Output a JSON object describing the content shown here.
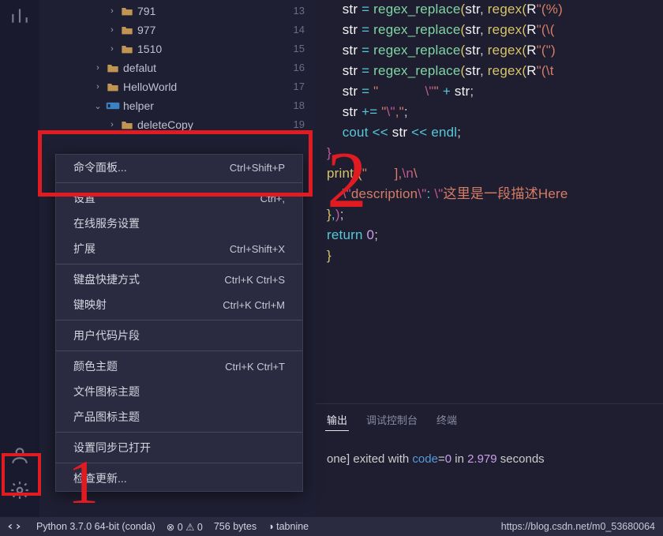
{
  "tree": [
    {
      "indent": 86,
      "chev": "›",
      "icon": "folder",
      "label": "791"
    },
    {
      "indent": 86,
      "chev": "›",
      "icon": "folder",
      "label": "977"
    },
    {
      "indent": 86,
      "chev": "›",
      "icon": "folder",
      "label": "1510"
    },
    {
      "indent": 68,
      "chev": "›",
      "icon": "folder",
      "label": "defalut"
    },
    {
      "indent": 68,
      "chev": "›",
      "icon": "folder",
      "label": "HelloWorld"
    },
    {
      "indent": 68,
      "chev": "⌄",
      "icon": "module",
      "label": "helper"
    },
    {
      "indent": 86,
      "chev": "›",
      "icon": "folder",
      "label": "deleteCopy"
    }
  ],
  "gutter": [
    "13",
    "14",
    "15",
    "16",
    "17",
    "18",
    "19"
  ],
  "menu": [
    {
      "label": "命令面板...",
      "shortcut": "Ctrl+Shift+P",
      "hi": true
    },
    {
      "sep": true
    },
    {
      "label": "设置",
      "shortcut": "Ctrl+,"
    },
    {
      "label": "在线服务设置",
      "shortcut": ""
    },
    {
      "label": "扩展",
      "shortcut": "Ctrl+Shift+X"
    },
    {
      "sep": true
    },
    {
      "label": "键盘快捷方式",
      "shortcut": "Ctrl+K Ctrl+S"
    },
    {
      "label": "键映射",
      "shortcut": "Ctrl+K Ctrl+M"
    },
    {
      "sep": true
    },
    {
      "label": "用户代码片段",
      "shortcut": ""
    },
    {
      "sep": true
    },
    {
      "label": "颜色主题",
      "shortcut": "Ctrl+K Ctrl+T"
    },
    {
      "label": "文件图标主题",
      "shortcut": ""
    },
    {
      "label": "产品图标主题",
      "shortcut": ""
    },
    {
      "sep": true
    },
    {
      "label": "设置同步已打开",
      "shortcut": ""
    },
    {
      "sep": true
    },
    {
      "label": "检查更新...",
      "shortcut": ""
    }
  ],
  "code_lines": [
    [
      [
        "    ",
        "p"
      ],
      [
        "str",
        "i"
      ],
      [
        " = ",
        "o"
      ],
      [
        "regex_replace",
        "f"
      ],
      [
        "(",
        "b"
      ],
      [
        "str",
        "i"
      ],
      [
        ", ",
        "p"
      ],
      [
        "regex",
        "c"
      ],
      [
        "(",
        "b"
      ],
      [
        "R",
        "i"
      ],
      [
        "\"(%)",
        "s"
      ]
    ],
    [
      [
        "    ",
        "p"
      ],
      [
        "str",
        "i"
      ],
      [
        " = ",
        "o"
      ],
      [
        "regex_replace",
        "f"
      ],
      [
        "(",
        "b"
      ],
      [
        "str",
        "i"
      ],
      [
        ", ",
        "p"
      ],
      [
        "regex",
        "c"
      ],
      [
        "(",
        "b"
      ],
      [
        "R",
        "i"
      ],
      [
        "\"(\\(",
        "s"
      ]
    ],
    [
      [
        "    ",
        "p"
      ],
      [
        "str",
        "i"
      ],
      [
        " = ",
        "o"
      ],
      [
        "regex_replace",
        "f"
      ],
      [
        "(",
        "b"
      ],
      [
        "str",
        "i"
      ],
      [
        ", ",
        "p"
      ],
      [
        "regex",
        "c"
      ],
      [
        "(",
        "b"
      ],
      [
        "R",
        "i"
      ],
      [
        "\"(\")",
        "s"
      ]
    ],
    [
      [
        "    ",
        "p"
      ],
      [
        "str",
        "i"
      ],
      [
        " = ",
        "o"
      ],
      [
        "regex_replace",
        "f"
      ],
      [
        "(",
        "b"
      ],
      [
        "str",
        "i"
      ],
      [
        ", ",
        "p"
      ],
      [
        "regex",
        "c"
      ],
      [
        "(",
        "b"
      ],
      [
        "R",
        "i"
      ],
      [
        "\"(\\t",
        "s"
      ]
    ],
    [
      [
        "    ",
        "p"
      ],
      [
        "str",
        "i"
      ],
      [
        " = ",
        "o"
      ],
      [
        "\"            ",
        "s"
      ],
      [
        "\\\"",
        "e"
      ],
      [
        "\"",
        "s"
      ],
      [
        " + ",
        "o"
      ],
      [
        "str",
        "i"
      ],
      [
        ";",
        "p"
      ]
    ],
    [
      [
        "    ",
        "p"
      ],
      [
        "str",
        "i"
      ],
      [
        " += ",
        "o"
      ],
      [
        "\"",
        "s"
      ],
      [
        "\\\"",
        "e"
      ],
      [
        ",\"",
        "s"
      ],
      [
        ";",
        "p"
      ]
    ],
    [
      [
        "    ",
        "p"
      ],
      [
        "cout",
        "k"
      ],
      [
        " << ",
        "o"
      ],
      [
        "str",
        "i"
      ],
      [
        " << ",
        "o"
      ],
      [
        "endl",
        "k"
      ],
      [
        ";",
        "p"
      ]
    ],
    [
      [
        "}",
        "b2"
      ]
    ],
    [
      [
        "printf",
        "c"
      ],
      [
        "(",
        "b"
      ],
      [
        "\"       ],",
        "s"
      ],
      [
        "\\n",
        "e"
      ],
      [
        "\\",
        "s"
      ]
    ],
    [
      [
        "    ",
        "p"
      ],
      [
        "\\\"",
        "e"
      ],
      [
        "description",
        "s"
      ],
      [
        "\\\"",
        "e"
      ],
      [
        ": ",
        "o"
      ],
      [
        "\\\"",
        "e"
      ],
      [
        "这里是一段描述Here",
        "s"
      ]
    ],
    [
      [
        "}",
        "b"
      ],
      [
        ",",
        "o"
      ],
      [
        ")",
        "b2"
      ],
      [
        ";",
        "p"
      ]
    ],
    [
      [
        "return",
        "k"
      ],
      [
        " ",
        "p"
      ],
      [
        "0",
        "n"
      ],
      [
        ";",
        "p"
      ]
    ],
    [
      [
        "}",
        "b"
      ]
    ]
  ],
  "panel_tabs": [
    {
      "label": "输出",
      "active": true
    },
    {
      "label": "调试控制台",
      "active": false
    },
    {
      "label": "终端",
      "active": false
    }
  ],
  "terminal": {
    "prefix": "one]",
    "exited": " exited with ",
    "code_word": "code",
    "eq": "=",
    "zero": "0",
    "in": " in ",
    "num": "2.979",
    "sec": " seconds"
  },
  "status": {
    "python": "Python 3.7.0 64-bit (conda)",
    "err_icon": "⊗",
    "err": "0",
    "warn_icon": "⚠",
    "warn": "0",
    "bytes": "756 bytes",
    "tabnine_icon": "◑",
    "tabnine": "tabnine",
    "watermark": "https://blog.csdn.net/m0_53680064"
  },
  "annotations": {
    "n1": "1",
    "n2": "2"
  }
}
